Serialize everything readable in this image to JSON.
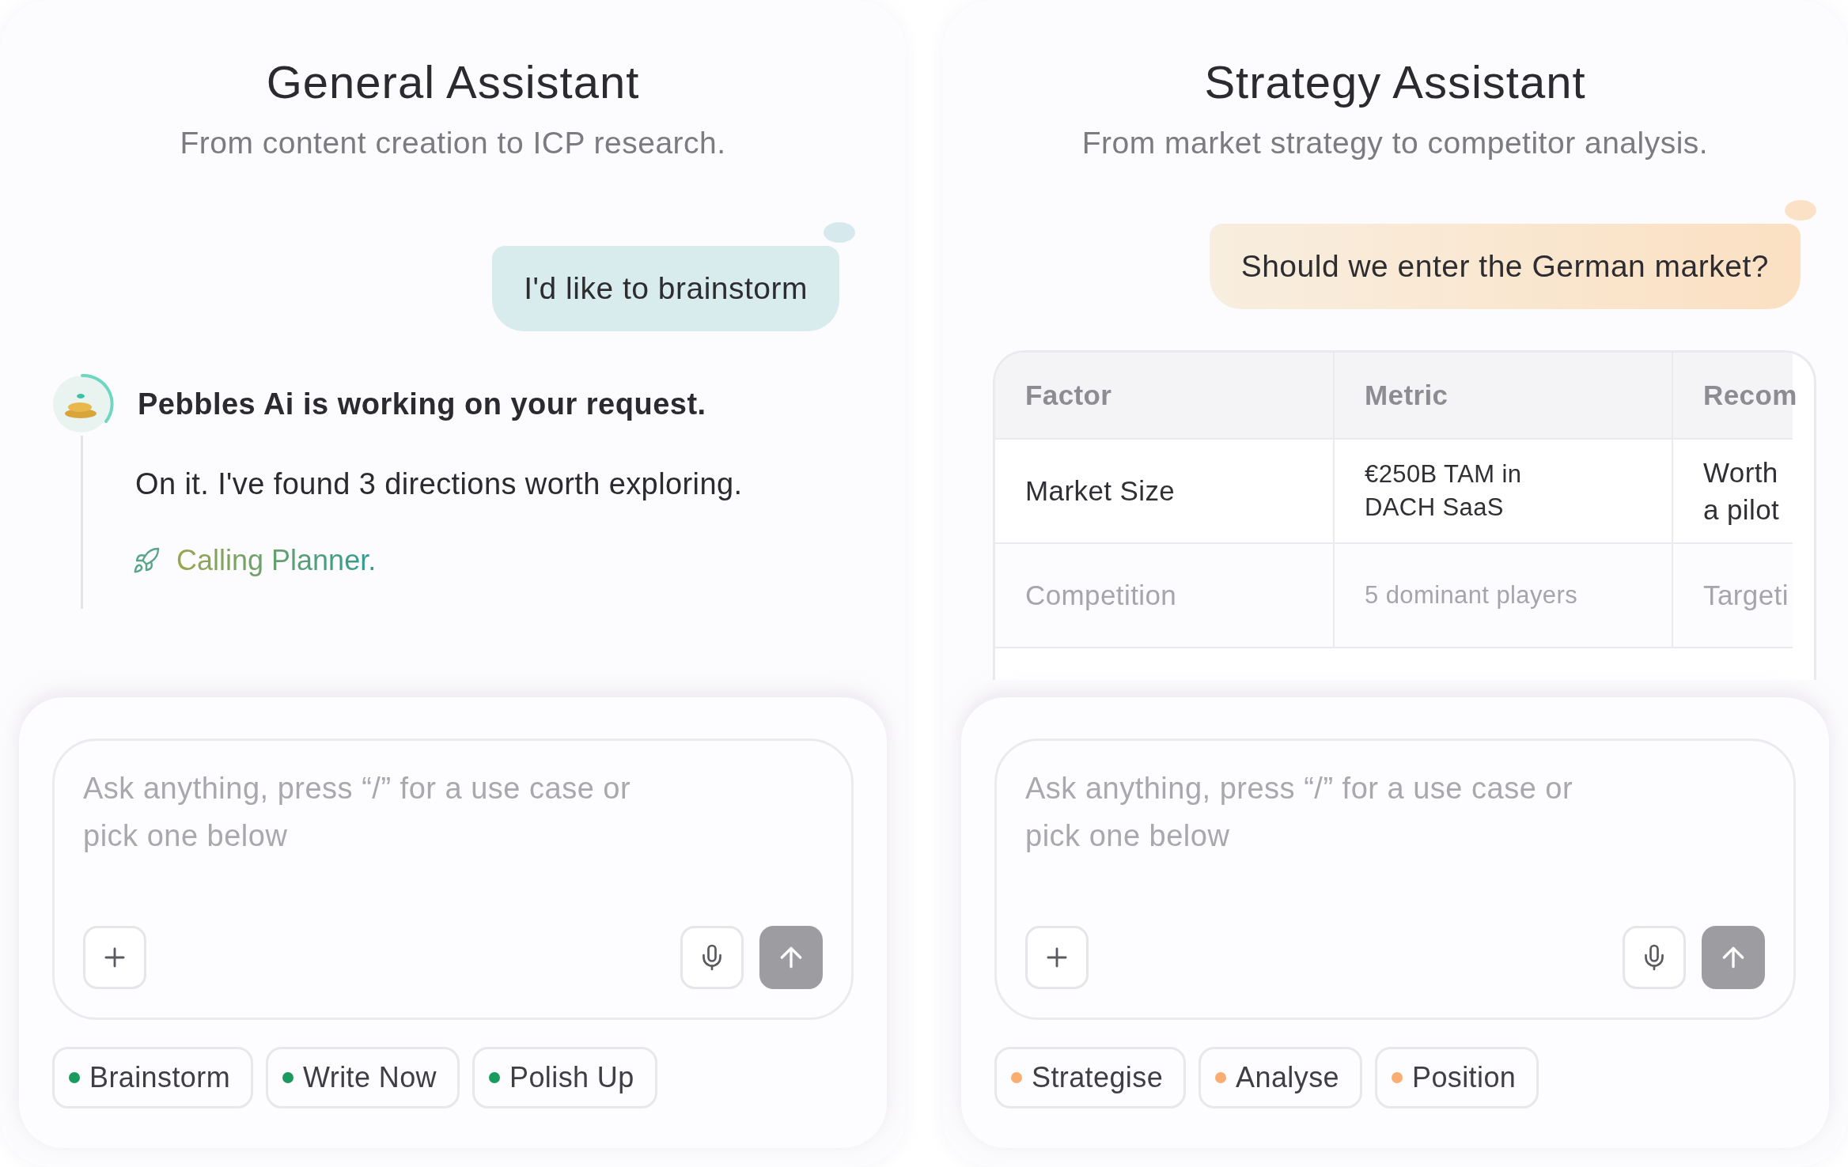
{
  "panels": [
    {
      "kind": "chat",
      "title": "General Assistant",
      "subtitle": "From content creation to ICP research.",
      "user_message": "I'd like to brainstorm",
      "status": "Pebbles Ai is working on your request.",
      "reply": "On it. I've found 3 directions worth exploring.",
      "tool_call": "Calling Planner.",
      "composer": {
        "placeholder": "Ask anything, press “/” for a use case or pick one below"
      },
      "chips": [
        {
          "label": "Brainstorm",
          "color": "#1a9a5c"
        },
        {
          "label": "Write Now",
          "color": "#1a9a5c"
        },
        {
          "label": "Polish Up",
          "color": "#1a9a5c"
        }
      ]
    },
    {
      "kind": "table",
      "title": "Strategy Assistant",
      "subtitle": "From market strategy to competitor analysis.",
      "user_message": "Should we enter the German market?",
      "table": {
        "columns": [
          "Factor",
          "Metric",
          "Recom"
        ],
        "rows": [
          {
            "cells": [
              "Market Size",
              "€250B TAM in\nDACH SaaS",
              "Worth\na pilot"
            ],
            "faded": false
          },
          {
            "cells": [
              "Competition",
              "5 dominant players",
              "Targeti"
            ],
            "faded": true
          }
        ]
      },
      "composer": {
        "placeholder": "Ask anything, press “/” for a use case or pick one below"
      },
      "chips": [
        {
          "label": "Strategise",
          "color": "#f9ad70"
        },
        {
          "label": "Analyse",
          "color": "#f9ad70"
        },
        {
          "label": "Position",
          "color": "#f9ad70"
        }
      ]
    }
  ]
}
